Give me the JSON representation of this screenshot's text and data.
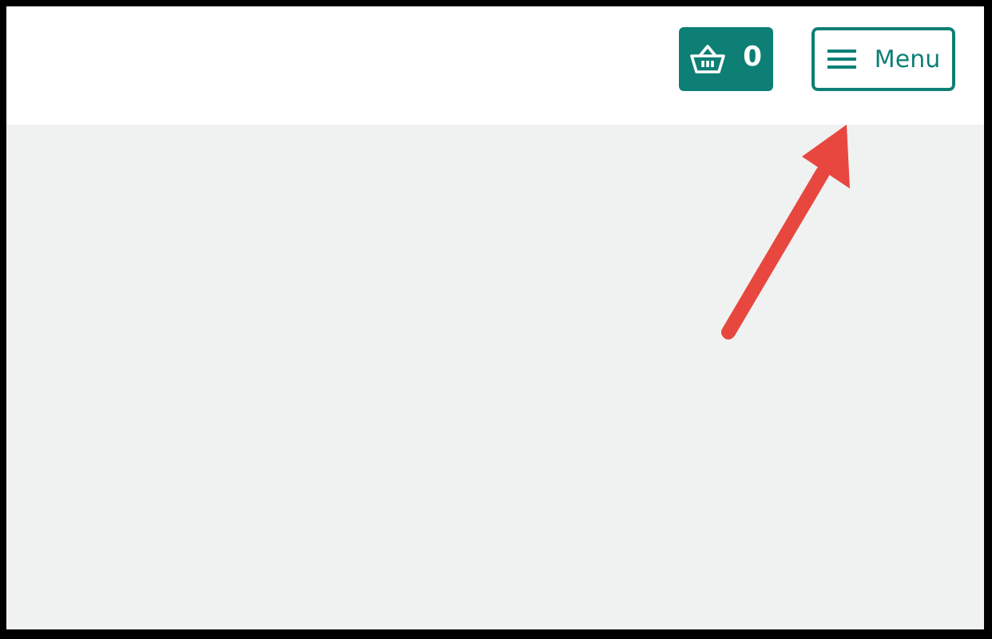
{
  "header": {
    "cart_button": {
      "count": "0"
    },
    "menu_button": {
      "label": "Menu"
    }
  }
}
